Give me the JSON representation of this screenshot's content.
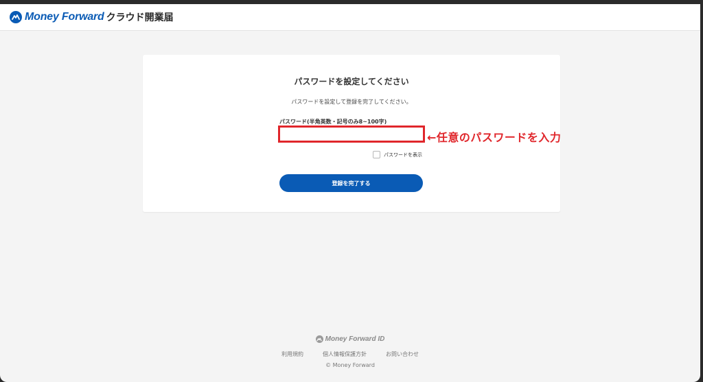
{
  "header": {
    "brand": "Money Forward",
    "product": "クラウド開業届"
  },
  "card": {
    "title": "パスワードを設定してください",
    "description": "パスワードを設定して登録を完了してください。",
    "password_label": "パスワード(半角英数・記号のみ8~100字)",
    "password_value": "",
    "show_password_label": "パスワードを表示",
    "show_password_checked": false,
    "submit_label": "登録を完了する"
  },
  "annotation": {
    "text": "←任意のパスワードを入力",
    "color": "#e0262b"
  },
  "footer": {
    "brand": "Money Forward ID",
    "links": [
      "利用規約",
      "個人情報保護方針",
      "お問い合わせ"
    ],
    "copyright": "© Money Forward"
  },
  "colors": {
    "brand_blue": "#0a5bb5",
    "highlight_red": "#e0262b",
    "page_bg": "#f4f4f4"
  },
  "icons": {
    "logo": "money-forward-logo-icon",
    "footer_logo": "money-forward-id-logo-icon"
  }
}
